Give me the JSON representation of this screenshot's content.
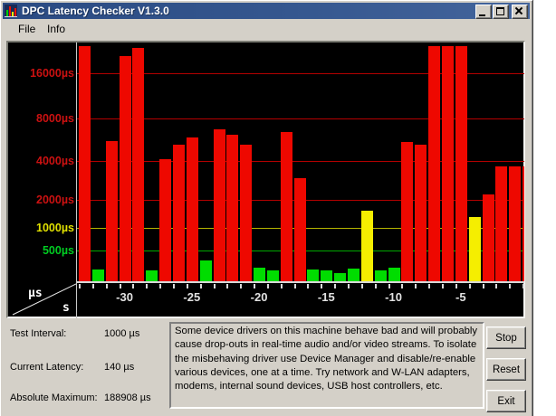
{
  "window": {
    "title": "DPC Latency Checker V1.3.0"
  },
  "menu": {
    "items": [
      "File",
      "Info"
    ]
  },
  "colors": {
    "red": "#ee0800",
    "green": "#00dd00",
    "yellow": "#f5ee00",
    "grid_red": "#b40000",
    "grid_yellow": "#b4b400",
    "grid_green": "#00a800",
    "label_red": "#cc1111",
    "label_yellow": "#e0e000",
    "label_green": "#00cc22",
    "titlebar_blue": "#35578f",
    "window_gray": "#d4d0c8",
    "chart_bg": "#000000"
  },
  "chart_data": {
    "type": "bar",
    "unit": "µs",
    "corner_top": "µs",
    "corner_bottom": "s",
    "y_scale": "log-like",
    "ylim": [
      0,
      24000
    ],
    "y_ticks": [
      {
        "label": "16000µs",
        "value": 16000,
        "color": "label_red",
        "line": "grid_red"
      },
      {
        "label": "8000µs",
        "value": 8000,
        "color": "label_red",
        "line": "grid_red"
      },
      {
        "label": "4000µs",
        "value": 4000,
        "color": "label_red",
        "line": "grid_red"
      },
      {
        "label": "2000µs",
        "value": 2000,
        "color": "label_red",
        "line": "grid_red"
      },
      {
        "label": "1000µs",
        "value": 1000,
        "color": "label_yellow",
        "line": "grid_yellow"
      },
      {
        "label": "500µs",
        "value": 500,
        "color": "label_green",
        "line": "grid_green"
      }
    ],
    "x_labels": [
      {
        "label": "-30",
        "bar": 4
      },
      {
        "label": "-25",
        "bar": 9
      },
      {
        "label": "-20",
        "bar": 14
      },
      {
        "label": "-15",
        "bar": 19
      },
      {
        "label": "-10",
        "bar": 24
      },
      {
        "label": "-5",
        "bar": 29
      }
    ],
    "bars": [
      {
        "v": 24000,
        "c": "red",
        "clipped": true
      },
      {
        "v": 180,
        "c": "green"
      },
      {
        "v": 5900,
        "c": "red"
      },
      {
        "v": 21000,
        "c": "red"
      },
      {
        "v": 23500,
        "c": "red"
      },
      {
        "v": 170,
        "c": "green"
      },
      {
        "v": 4200,
        "c": "red"
      },
      {
        "v": 5500,
        "c": "red"
      },
      {
        "v": 6200,
        "c": "red"
      },
      {
        "v": 330,
        "c": "green"
      },
      {
        "v": 7000,
        "c": "red"
      },
      {
        "v": 6500,
        "c": "red"
      },
      {
        "v": 5500,
        "c": "red"
      },
      {
        "v": 210,
        "c": "green"
      },
      {
        "v": 170,
        "c": "green"
      },
      {
        "v": 6700,
        "c": "red"
      },
      {
        "v": 3100,
        "c": "red"
      },
      {
        "v": 180,
        "c": "green"
      },
      {
        "v": 170,
        "c": "green"
      },
      {
        "v": 120,
        "c": "green"
      },
      {
        "v": 200,
        "c": "green"
      },
      {
        "v": 1600,
        "c": "yellow"
      },
      {
        "v": 170,
        "c": "green"
      },
      {
        "v": 210,
        "c": "green"
      },
      {
        "v": 5800,
        "c": "red"
      },
      {
        "v": 5500,
        "c": "red"
      },
      {
        "v": 24000,
        "c": "red",
        "clipped": true
      },
      {
        "v": 24000,
        "c": "red",
        "clipped": true
      },
      {
        "v": 24000,
        "c": "red",
        "clipped": true
      },
      {
        "v": 1400,
        "c": "yellow"
      },
      {
        "v": 2300,
        "c": "red"
      },
      {
        "v": 3700,
        "c": "red"
      },
      {
        "v": 3700,
        "c": "red"
      },
      {
        "v": 3700,
        "c": "red",
        "clipped": true
      }
    ]
  },
  "panel": {
    "fields": [
      {
        "label": "Test Interval:",
        "value": "1000 µs"
      },
      {
        "label": "Current Latency:",
        "value": "140 µs"
      },
      {
        "label": "Absolute Maximum:",
        "value": "188908 µs"
      }
    ],
    "info_text": "Some device drivers on this machine behave bad and will probably cause drop-outs in real-time audio and/or video streams. To isolate the misbehaving driver use Device Manager and disable/re-enable various devices, one at a time. Try network and W-LAN adapters, modems, internal sound devices, USB host controllers, etc.",
    "buttons": [
      {
        "label": "Stop"
      },
      {
        "label": "Reset"
      },
      {
        "label": "Exit"
      }
    ]
  }
}
